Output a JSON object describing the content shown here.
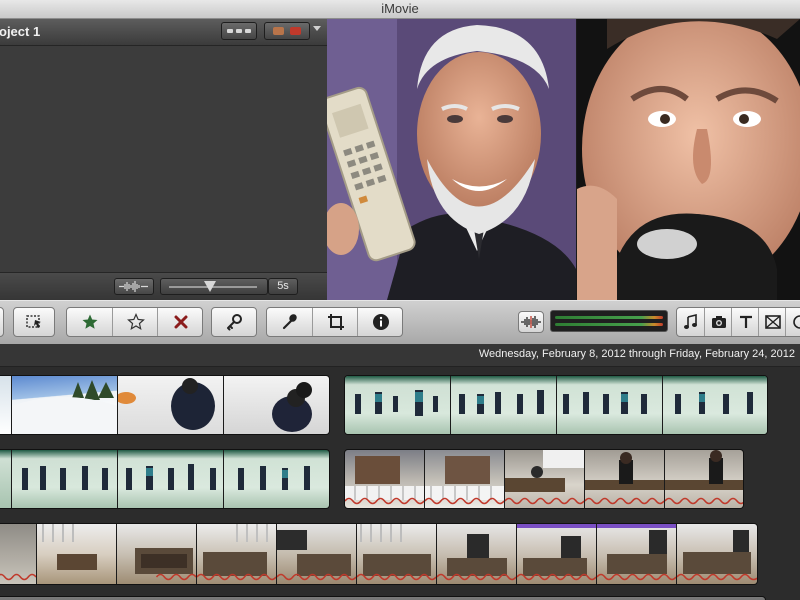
{
  "window": {
    "title": "iMovie"
  },
  "project": {
    "title": "oject 1",
    "clip_duration": "5s",
    "zoom_level": 0.47
  },
  "event": {
    "date_range": "Wednesday, February 8, 2012 through Friday, February 24, 2012"
  },
  "toolbar": {
    "tools": [
      "record-button",
      "mark-favorite-star",
      "unmark-star",
      "reject-x",
      "keyword-key",
      "voiceover-microphone",
      "crop",
      "inspector-info"
    ],
    "media_browsers": [
      "music-note",
      "photo-camera",
      "title-T",
      "transition",
      "maps-globe"
    ]
  },
  "colors": {
    "favorite_green": "#2d6a34",
    "reject_red": "#8b1c1c",
    "audio_wave": "#c0392b",
    "purple_marker": "#7a4fc4"
  }
}
